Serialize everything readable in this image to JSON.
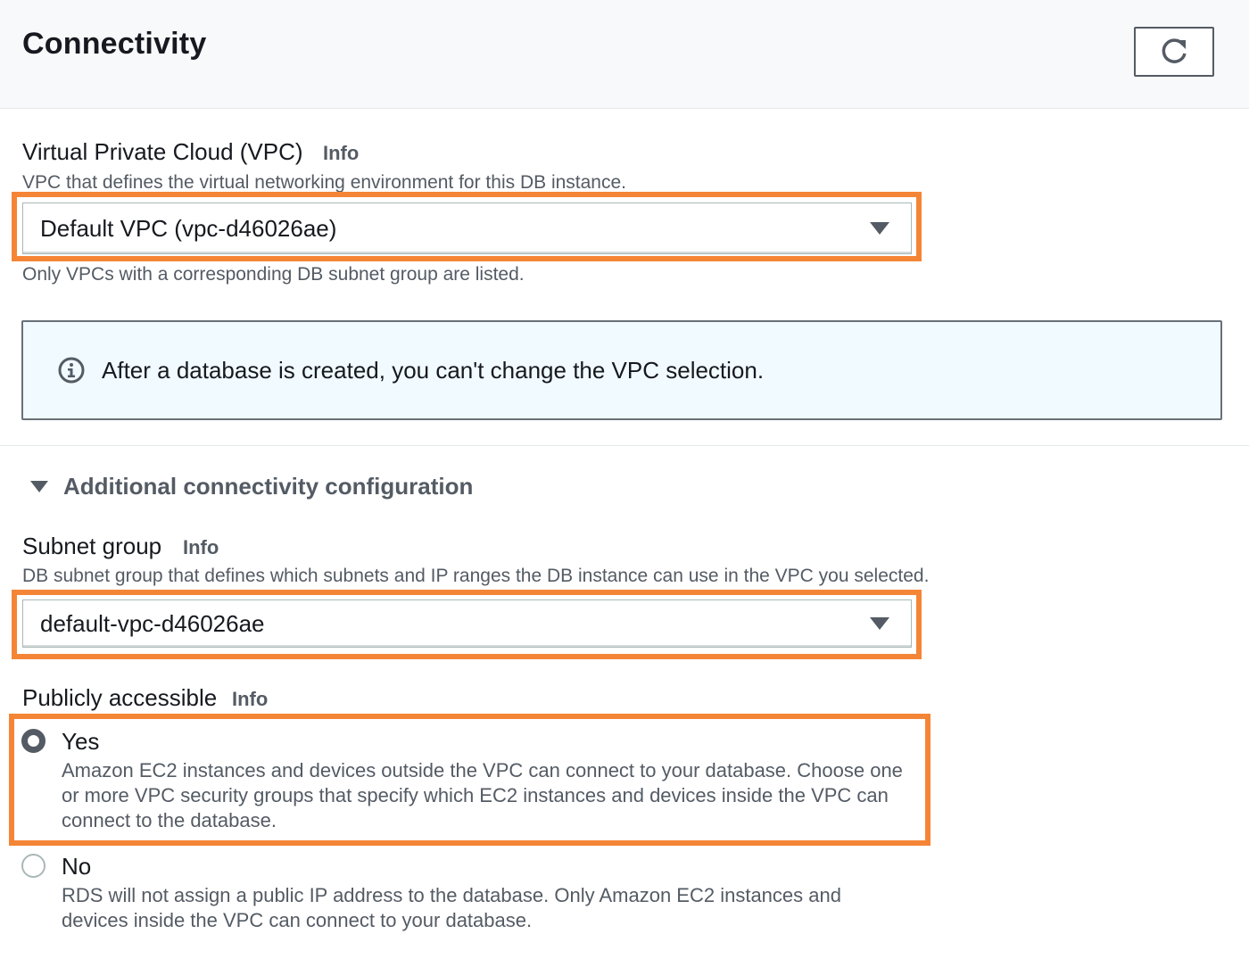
{
  "header": {
    "title": "Connectivity",
    "refresh_icon": "refresh-icon"
  },
  "vpc": {
    "label": "Virtual Private Cloud (VPC)",
    "info": "Info",
    "description": "VPC that defines the virtual networking environment for this DB instance.",
    "selected": "Default VPC (vpc-d46026ae)",
    "hint": "Only VPCs with a corresponding DB subnet group are listed."
  },
  "alert": {
    "icon": "info-circle-icon",
    "text": "After a database is created, you can't change the VPC selection."
  },
  "additional": {
    "label": "Additional connectivity configuration",
    "expanded": true
  },
  "subnet": {
    "label": "Subnet group",
    "info": "Info",
    "description": "DB subnet group that defines which subnets and IP ranges the DB instance can use in the VPC you selected.",
    "selected": "default-vpc-d46026ae"
  },
  "public": {
    "label": "Publicly accessible",
    "info": "Info",
    "selected": "Yes",
    "options": [
      {
        "label": "Yes",
        "desc_lines": [
          "Amazon EC2 instances and devices outside the VPC can connect to your database. Choose one",
          "or more VPC security groups that specify which EC2 instances and devices inside the VPC can",
          "connect to the database."
        ]
      },
      {
        "label": "No",
        "desc_lines": [
          "RDS will not assign a public IP address to the database. Only Amazon EC2 instances and",
          "devices inside the VPC can connect to your database."
        ]
      }
    ]
  },
  "colors": {
    "highlight": "#f58536",
    "text": "#16191f",
    "muted": "#545b64",
    "alert_bg": "#f1faff"
  }
}
